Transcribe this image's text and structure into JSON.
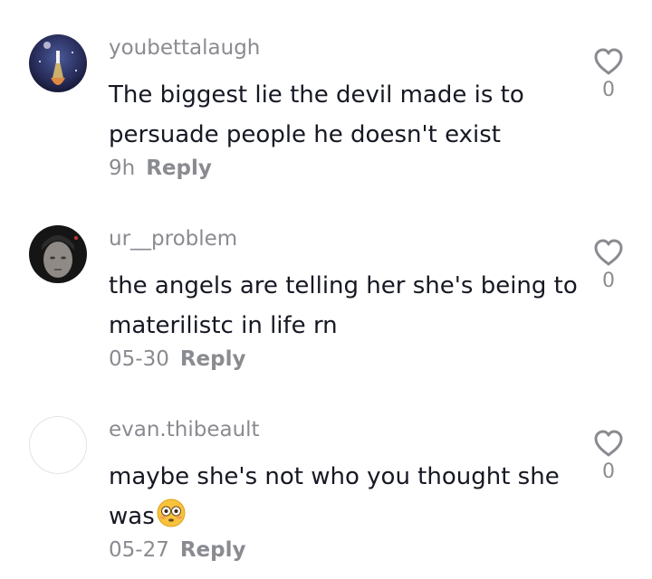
{
  "comments": [
    {
      "username": "youbettalaugh",
      "text": "The biggest lie the devil made is to persuade people he doesn't exist",
      "time": "9h",
      "reply_label": "Reply",
      "likes": "0",
      "avatar": "rocket-launch-avatar"
    },
    {
      "username": "ur__problem",
      "text": "the angels are telling her she's being to materilistc in life rn",
      "time": "05-30",
      "reply_label": "Reply",
      "likes": "0",
      "avatar": "person-photo-avatar"
    },
    {
      "username": "evan.thibeault",
      "text": "maybe she's not who you thought she was",
      "emoji": "flushed-face-emoji",
      "time": "05-27",
      "reply_label": "Reply",
      "likes": "0",
      "avatar": "blank-avatar"
    }
  ],
  "colors": {
    "secondary_text": "#8a8b91",
    "primary_text": "#161823",
    "background": "#ffffff"
  },
  "icons": {
    "like": "heart-outline-icon"
  }
}
